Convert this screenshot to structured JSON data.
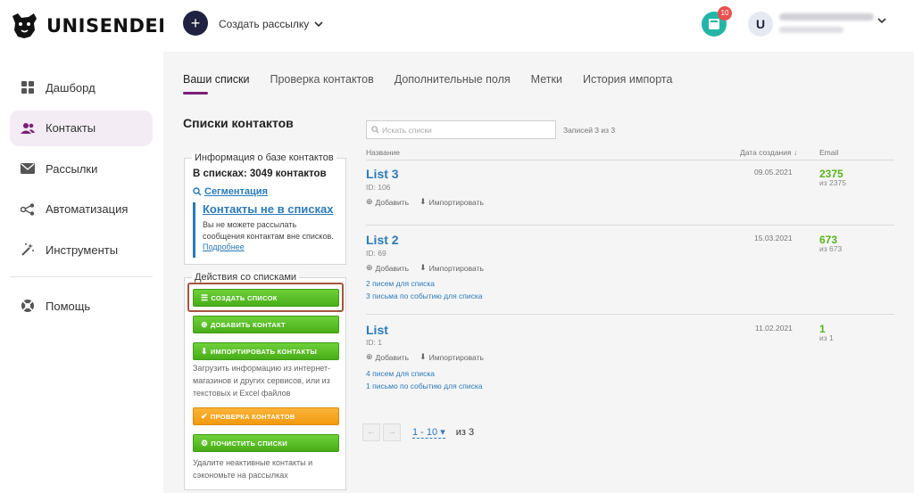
{
  "brand": {
    "name": "UNISENDER"
  },
  "nav": [
    {
      "label": "Дашборд",
      "icon": "grid-icon",
      "active": false
    },
    {
      "label": "Контакты",
      "icon": "users-icon",
      "active": true
    },
    {
      "label": "Рассылки",
      "icon": "mail-icon",
      "active": false
    },
    {
      "label": "Автоматизация",
      "icon": "share-icon",
      "active": false
    },
    {
      "label": "Инструменты",
      "icon": "magic-wand-icon",
      "active": false
    }
  ],
  "help": {
    "label": "Помощь"
  },
  "topbar": {
    "create_label": "Создать рассылку",
    "notifications_count": "10",
    "avatar_letter": "U"
  },
  "tabs": [
    {
      "label": "Ваши списки",
      "active": true
    },
    {
      "label": "Проверка контактов",
      "active": false
    },
    {
      "label": "Дополнительные поля",
      "active": false
    },
    {
      "label": "Метки",
      "active": false
    },
    {
      "label": "История импорта",
      "active": false
    }
  ],
  "section_title": "Списки контактов",
  "info_box": {
    "legend": "Информация о базе контактов",
    "in_lists": "В списках: 3049 контактов",
    "segmentation": "Сегментация",
    "not_in_title": "Контакты не в списках",
    "not_in_text": "Вы не можете рассылать сообщения контактам вне списков.",
    "more": "Подробнее"
  },
  "actions_box": {
    "legend": "Действия со списками",
    "create_list": "СОЗДАТЬ СПИСОК",
    "add_contact": "ДОБАВИТЬ КОНТАКТ",
    "import_contacts": "ИМПОРТИРОВАТЬ КОНТАКТЫ",
    "import_hint": "Загрузить информацию из интернет-магазинов и других сервисов, или из текстовых и Excel файлов",
    "check_contacts": "ПРОВЕРКА КОНТАКТОВ",
    "clean_lists": "ПОЧИСТИТЬ СПИСКИ",
    "clean_hint": "Удалите неактивные контакты и сэкономьте на рассылках"
  },
  "table": {
    "search_placeholder": "Искать списки",
    "records": "Записей 3 из 3",
    "col_name": "Название",
    "col_date": "Дата создания ↓",
    "col_email": "Email",
    "add_label": "Добавить",
    "import_label": "Импортировать",
    "rows": [
      {
        "name": "List 3",
        "id": "ID: 106",
        "date": "09.05.2021",
        "count": "2375",
        "of": "из 2375",
        "link1": "",
        "link2": ""
      },
      {
        "name": "List 2",
        "id": "ID: 69",
        "date": "15.03.2021",
        "count": "673",
        "of": "из 673",
        "link1": "2 писем для списка",
        "link2": "3 письма по событию для списка"
      },
      {
        "name": "List",
        "id": "ID: 1",
        "date": "11.02.2021",
        "count": "1",
        "of": "из 1",
        "link1": "4 писем для списка",
        "link2": "1 письмо по событию для списка"
      }
    ]
  },
  "pager": {
    "range": "1 - 10",
    "of": "из 3"
  },
  "colors": {
    "accent": "#7c1f75",
    "link": "#2b7bb9",
    "green": "#58b51c",
    "dark": "#1f2240"
  }
}
